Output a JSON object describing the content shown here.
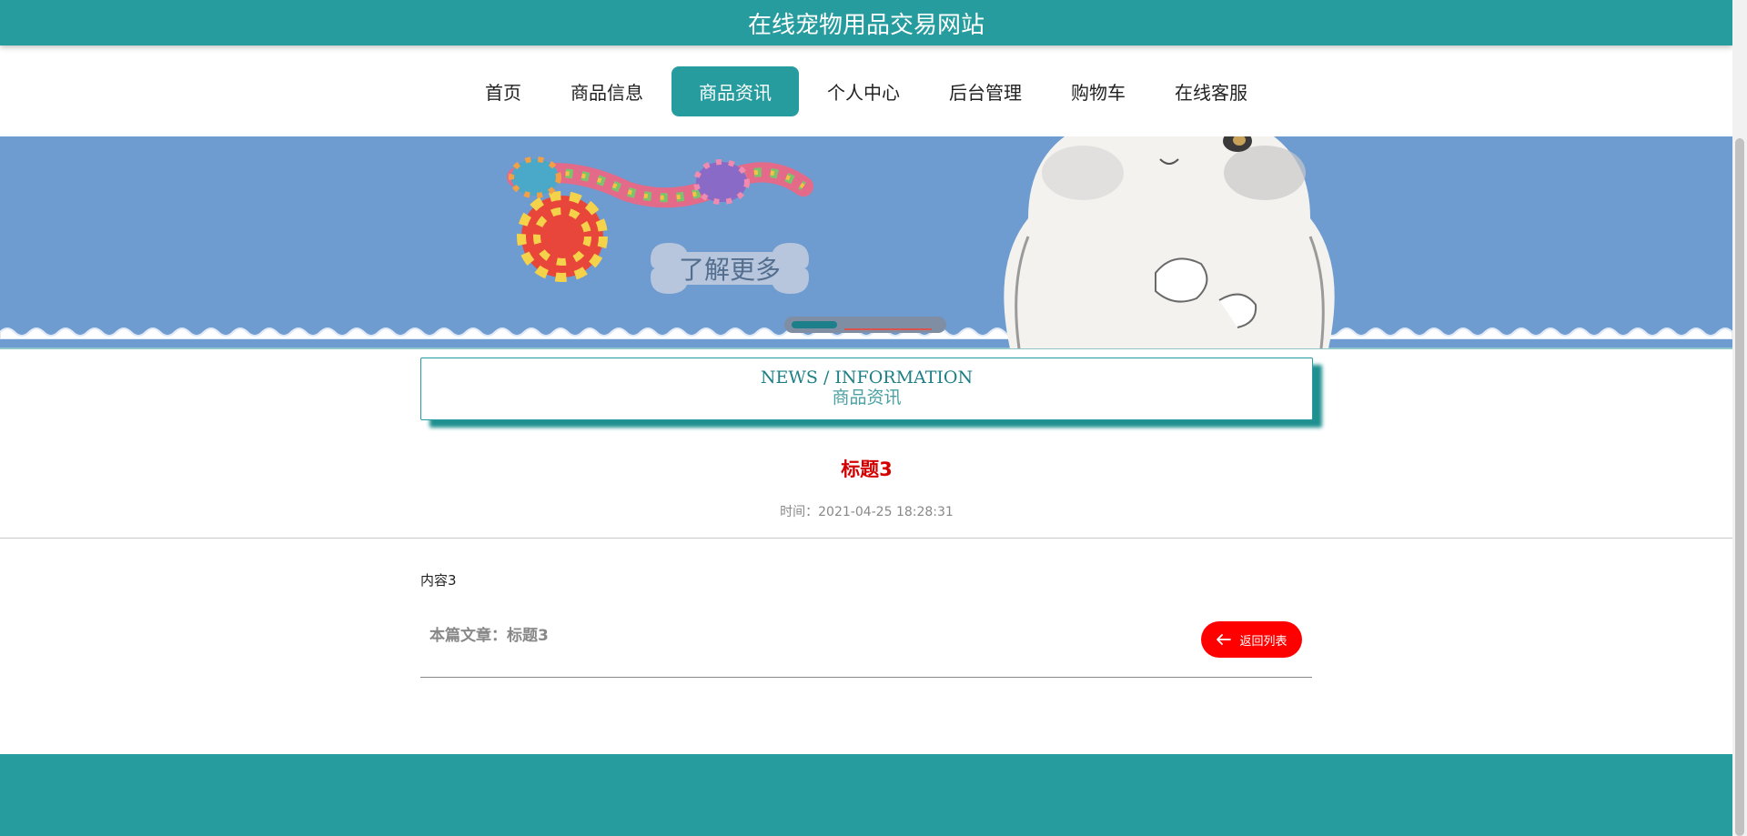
{
  "header": {
    "site_title": "在线宠物用品交易网站"
  },
  "nav": {
    "items": [
      {
        "label": "首页"
      },
      {
        "label": "商品信息"
      },
      {
        "label": "商品资讯",
        "active": true
      },
      {
        "label": "个人中心"
      },
      {
        "label": "后台管理"
      },
      {
        "label": "购物车"
      },
      {
        "label": "在线客服"
      }
    ]
  },
  "banner": {
    "learn_more": "了解更多",
    "active_slide": 1
  },
  "section": {
    "title_en": "NEWS / INFORMATION",
    "title_cn": "商品资讯"
  },
  "article": {
    "title": "标题3",
    "time": "时间：2021-04-25 18:28:31",
    "content": "内容3",
    "current_label": "本篇文章：标题3",
    "back_label": "返回列表"
  },
  "colors": {
    "primary": "#279c9e",
    "banner_bg": "#6e9bd0",
    "title_red": "#d40000",
    "back_button": "#ff0000"
  },
  "icons": {
    "back": "arrow-left-icon"
  }
}
